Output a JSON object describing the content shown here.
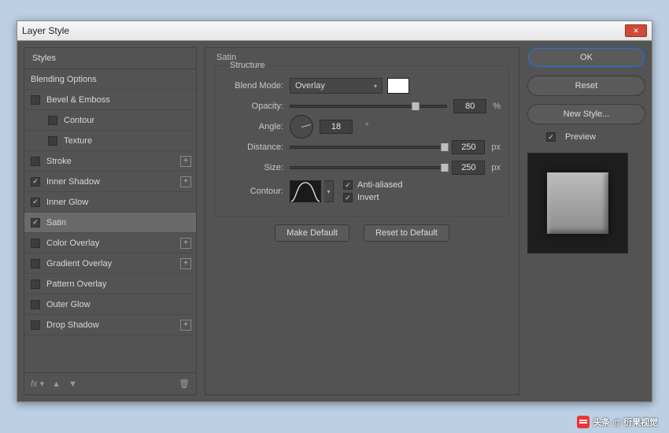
{
  "dialog": {
    "title": "Layer Style"
  },
  "sidebar": {
    "header": "Styles",
    "blending": "Blending Options",
    "items": [
      {
        "label": "Bevel & Emboss",
        "checked": false,
        "plus": false,
        "indent": false
      },
      {
        "label": "Contour",
        "checked": false,
        "plus": false,
        "indent": true
      },
      {
        "label": "Texture",
        "checked": false,
        "plus": false,
        "indent": true
      },
      {
        "label": "Stroke",
        "checked": false,
        "plus": true,
        "indent": false
      },
      {
        "label": "Inner Shadow",
        "checked": true,
        "plus": true,
        "indent": false
      },
      {
        "label": "Inner Glow",
        "checked": true,
        "plus": false,
        "indent": false
      },
      {
        "label": "Satin",
        "checked": true,
        "plus": false,
        "indent": false,
        "selected": true
      },
      {
        "label": "Color Overlay",
        "checked": false,
        "plus": true,
        "indent": false
      },
      {
        "label": "Gradient Overlay",
        "checked": false,
        "plus": true,
        "indent": false
      },
      {
        "label": "Pattern Overlay",
        "checked": false,
        "plus": false,
        "indent": false
      },
      {
        "label": "Outer Glow",
        "checked": false,
        "plus": false,
        "indent": false
      },
      {
        "label": "Drop Shadow",
        "checked": false,
        "plus": true,
        "indent": false
      }
    ],
    "footer_fx": "fx"
  },
  "panel": {
    "title": "Satin",
    "group": "Structure",
    "labels": {
      "blend_mode": "Blend Mode:",
      "opacity": "Opacity:",
      "angle": "Angle:",
      "distance": "Distance:",
      "size": "Size:",
      "contour": "Contour:"
    },
    "blend_mode_value": "Overlay",
    "swatch_color": "#ffffff",
    "opacity": {
      "value": "80",
      "unit": "%",
      "pct": 80
    },
    "angle": {
      "value": "18",
      "unit": "°"
    },
    "distance": {
      "value": "250",
      "unit": "px",
      "pct": 100
    },
    "size": {
      "value": "250",
      "unit": "px",
      "pct": 100
    },
    "anti_aliased": {
      "label": "Anti-aliased",
      "checked": true
    },
    "invert": {
      "label": "Invert",
      "checked": true
    },
    "buttons": {
      "make_default": "Make Default",
      "reset_default": "Reset to Default"
    }
  },
  "right": {
    "ok": "OK",
    "reset": "Reset",
    "new_style": "New Style...",
    "preview_label": "Preview",
    "preview_checked": true
  },
  "watermark": "头条 @ 衍果视觉"
}
